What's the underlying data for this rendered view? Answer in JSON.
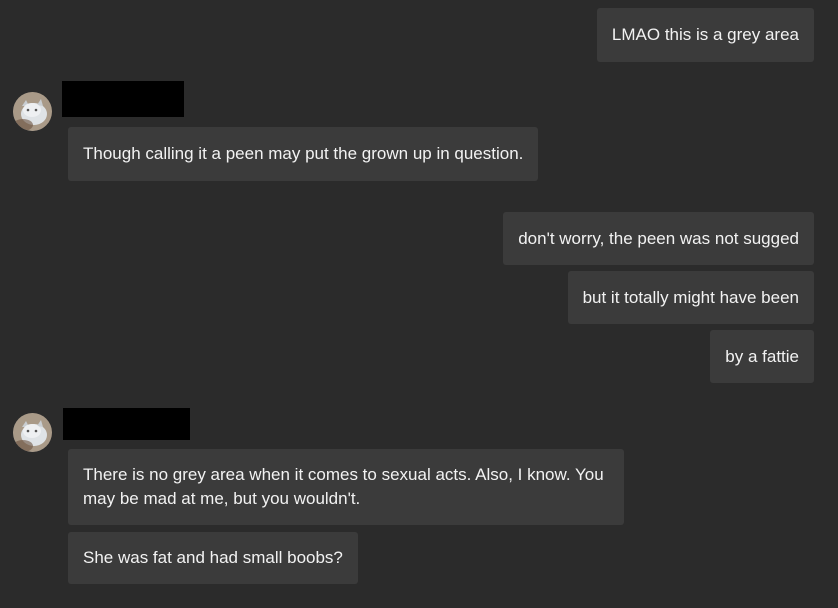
{
  "conversation": {
    "messages": {
      "m1": "LMAO this is a grey area",
      "m2": "Though calling it a peen may put the grown up in question.",
      "m3": "don't worry, the peen was not sugged",
      "m4": "but it totally might have been",
      "m5": "by a fattie",
      "m6": "There is no grey area when it comes to sexual acts. Also, I know. You may be mad at me, but you wouldn't.",
      "m7": "She was fat and had small boobs?"
    }
  },
  "colors": {
    "background": "#2b2b2b",
    "bubble": "#3b3b3b",
    "text": "#f2f2f2",
    "redaction": "#000000"
  },
  "icons": {
    "avatar": "cat-avatar-icon"
  }
}
